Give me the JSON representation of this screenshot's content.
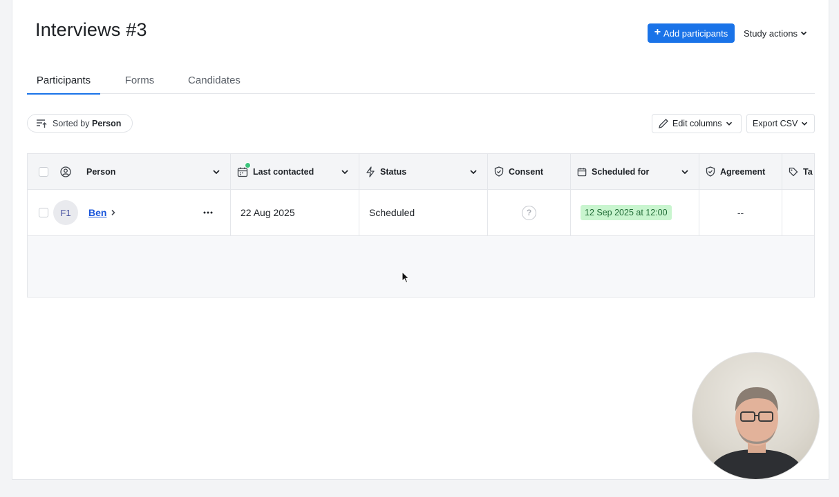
{
  "header": {
    "title": "Interviews #3",
    "add_participants_label": "Add participants",
    "study_actions_label": "Study actions"
  },
  "tabs": [
    {
      "label": "Participants",
      "active": true
    },
    {
      "label": "Forms",
      "active": false
    },
    {
      "label": "Candidates",
      "active": false
    }
  ],
  "toolbar": {
    "sorted_by_prefix": "Sorted by",
    "sorted_by_field": "Person",
    "edit_columns_label": "Edit columns",
    "export_csv_label": "Export CSV"
  },
  "table": {
    "columns": [
      {
        "label": "Person",
        "icon": "user-circle-icon"
      },
      {
        "label": "Last contacted",
        "icon": "calendar-icon"
      },
      {
        "label": "Status",
        "icon": "bolt-icon"
      },
      {
        "label": "Consent",
        "icon": "shield-icon"
      },
      {
        "label": "Scheduled for",
        "icon": "calendar-icon"
      },
      {
        "label": "Agreement",
        "icon": "shield-icon"
      },
      {
        "label": "Ta",
        "icon": "tag-icon"
      }
    ],
    "rows": [
      {
        "avatar_initials": "F1",
        "person": "Ben",
        "last_contacted": "22 Aug 2025",
        "status": "Scheduled",
        "consent_icon": "question-circle-icon",
        "scheduled_for": "12 Sep 2025 at 12:00",
        "agreement": "--"
      }
    ]
  },
  "colors": {
    "accent": "#1a73e8",
    "link": "#1a56db",
    "scheduled_badge_bg": "#c9f5cf",
    "scheduled_badge_text": "#1f6b35",
    "notification_dot": "#3cc47c"
  }
}
